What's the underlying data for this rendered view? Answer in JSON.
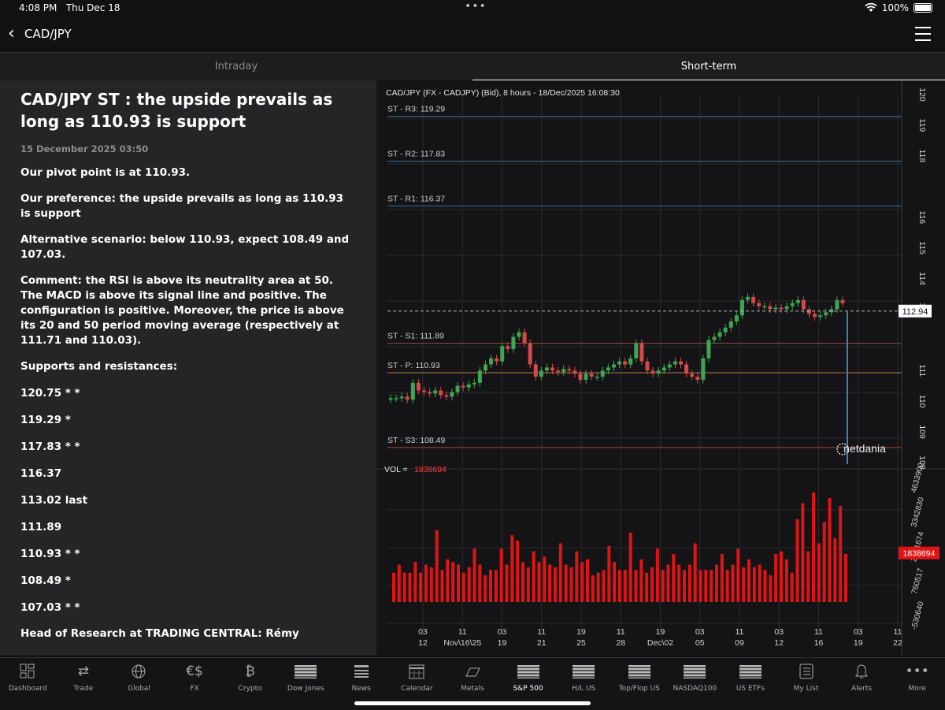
{
  "status": {
    "time": "4:08 PM",
    "date": "Thu Dec 18",
    "battery": "100%"
  },
  "nav": {
    "title": "CAD/JPY"
  },
  "tabs": {
    "intraday": "Intraday",
    "short_term": "Short-term"
  },
  "article": {
    "title": "CAD/JPY ST : the upside prevails as long as 110.93 is support",
    "date": "15 December 2025 03:50",
    "pivot": "Our pivot point is at 110.93.",
    "preference": "Our preference: the upside prevails as long as 110.93 is support",
    "alternative": "Alternative scenario: below 110.93, expect 108.49 and 107.03.",
    "comment": "Comment: the RSI is above its neutrality area at 50. The MACD is above its signal line and positive. The configuration is positive. Moreover, the price is above its 20 and 50 period moving average (respectively at 111.71 and 110.03).",
    "sr_heading": "Supports and resistances:",
    "levels": [
      "120.75 * *",
      "119.29 *",
      "117.83 * *",
      "116.37",
      "113.02 last",
      "111.89",
      "110.93 * *",
      "108.49 *",
      "107.03 * *"
    ],
    "author": "Head of Research at TRADING CENTRAL: Rémy"
  },
  "chart_data": {
    "type": "candlestick",
    "title": "CAD/JPY (FX - CADJPY) (Bid), 8 hours - 18/Dec/2025 16:08:30",
    "last_price": "112.94",
    "price_ylim": [
      108,
      120
    ],
    "price_ticks": [
      "120",
      "119",
      "118",
      "116",
      "115",
      "114",
      "113",
      "111",
      "110",
      "109",
      "108"
    ],
    "levels": [
      {
        "label": "ST - R3: 119.29",
        "value": 119.29,
        "color": "#3f6f98"
      },
      {
        "label": "ST - R2: 117.83",
        "value": 117.83,
        "color": "#3f6f98"
      },
      {
        "label": "ST - R1: 116.37",
        "value": 116.37,
        "color": "#3f6f98"
      },
      {
        "label": "ST - S1: 111.89",
        "value": 111.89,
        "color": "#9c4a3a"
      },
      {
        "label": "ST - P: 110.93",
        "value": 110.93,
        "color": "#b0784a"
      },
      {
        "label": "ST - S3: 108.49",
        "value": 108.49,
        "color": "#9c4a3a"
      }
    ],
    "closes": [
      110.1,
      110.1,
      110.15,
      110.05,
      110.6,
      110.35,
      110.3,
      110.25,
      110.35,
      110.2,
      110.15,
      110.3,
      110.5,
      110.45,
      110.55,
      110.6,
      111.0,
      111.2,
      111.4,
      111.3,
      111.8,
      111.7,
      112.1,
      112.25,
      111.9,
      111.2,
      110.8,
      111.0,
      111.1,
      111.0,
      110.95,
      111.05,
      111.0,
      110.9,
      110.7,
      110.9,
      110.8,
      110.8,
      111.0,
      111.1,
      111.2,
      111.3,
      111.2,
      111.4,
      111.9,
      111.3,
      111.0,
      110.9,
      111.0,
      111.1,
      111.2,
      111.3,
      111.2,
      110.9,
      110.8,
      110.7,
      111.4,
      112.0,
      112.1,
      112.25,
      112.4,
      112.6,
      112.8,
      113.3,
      113.4,
      113.2,
      113.1,
      113.1,
      113.0,
      113.05,
      113.0,
      113.1,
      113.2,
      113.3,
      113.0,
      112.85,
      112.75,
      112.8,
      112.9,
      113.0,
      113.3,
      113.2
    ],
    "volume_label": "VOL = ",
    "volume_last": "1838694",
    "volume_ylim": [
      -530640,
      4633900
    ],
    "volume_ticks": [
      "4633900",
      "3342830",
      "2051674",
      "760517",
      "-530640"
    ],
    "volumes": [
      1100000,
      1400000,
      1100000,
      1100000,
      1500000,
      1100000,
      1400000,
      1300000,
      2700000,
      1200000,
      1600000,
      1500000,
      1400000,
      1100000,
      1300000,
      2000000,
      1400000,
      1000000,
      1200000,
      1200000,
      2000000,
      1400000,
      2500000,
      2300000,
      1500000,
      1300000,
      1900000,
      1500000,
      1700000,
      1400000,
      1300000,
      2200000,
      1400000,
      1300000,
      1900000,
      1500000,
      1600000,
      1000000,
      1100000,
      1200000,
      2100000,
      1500000,
      1200000,
      1200000,
      2600000,
      1200000,
      1600000,
      1100000,
      1300000,
      2000000,
      1200000,
      1400000,
      1800000,
      1400000,
      1200000,
      1400000,
      2200000,
      1200000,
      1200000,
      1200000,
      1400000,
      1800000,
      1200000,
      1400000,
      2000000,
      1300000,
      1600000,
      1300000,
      1400000,
      1200000,
      1000000,
      1800000,
      1900000,
      1600000,
      1100000,
      3100000,
      3700000,
      1900000,
      4100000,
      2200000,
      3000000,
      3900000,
      2400000,
      3600000,
      1800000
    ],
    "x_ticks": [
      {
        "top": "03",
        "bottom": "12"
      },
      {
        "top": "11",
        "bottom": "Nov\\16\\25"
      },
      {
        "top": "03",
        "bottom": "19"
      },
      {
        "top": "11",
        "bottom": "21"
      },
      {
        "top": "19",
        "bottom": "25"
      },
      {
        "top": "11",
        "bottom": "28"
      },
      {
        "top": "19",
        "bottom": "Dec\\02"
      },
      {
        "top": "03",
        "bottom": "05"
      },
      {
        "top": "11",
        "bottom": "09"
      },
      {
        "top": "03",
        "bottom": "12"
      },
      {
        "top": "11",
        "bottom": "16"
      },
      {
        "top": "03",
        "bottom": "19"
      },
      {
        "top": "11",
        "bottom": "22"
      }
    ],
    "watermark": "netdania"
  },
  "toolbar": {
    "items": [
      {
        "label": "Dashboard",
        "icon": "dashboard-icon"
      },
      {
        "label": "Trade",
        "icon": "trade-icon"
      },
      {
        "label": "Global",
        "icon": "globe-icon"
      },
      {
        "label": "FX",
        "icon": "fx-icon"
      },
      {
        "label": "Crypto",
        "icon": "bitcoin-icon"
      },
      {
        "label": "Dow Jones",
        "icon": "us-flag-icon"
      },
      {
        "label": "News",
        "icon": "news-icon"
      },
      {
        "label": "Calendar",
        "icon": "calendar-icon"
      },
      {
        "label": "Metals",
        "icon": "gold-bar-icon"
      },
      {
        "label": "S&P 500",
        "icon": "us-flag-icon"
      },
      {
        "label": "H/L US",
        "icon": "us-flag-icon"
      },
      {
        "label": "Top/Flop US",
        "icon": "us-flag-icon"
      },
      {
        "label": "NASDAQ100",
        "icon": "us-flag-icon"
      },
      {
        "label": "US ETFs",
        "icon": "us-flag-icon"
      },
      {
        "label": "My List",
        "icon": "list-icon"
      },
      {
        "label": "Alerts",
        "icon": "bell-icon"
      },
      {
        "label": "More",
        "icon": "more-icon"
      }
    ],
    "icon_glyphs": {
      "fx": "€$",
      "crypto": "₿",
      "trade": "⇄",
      "more": "•••"
    }
  }
}
